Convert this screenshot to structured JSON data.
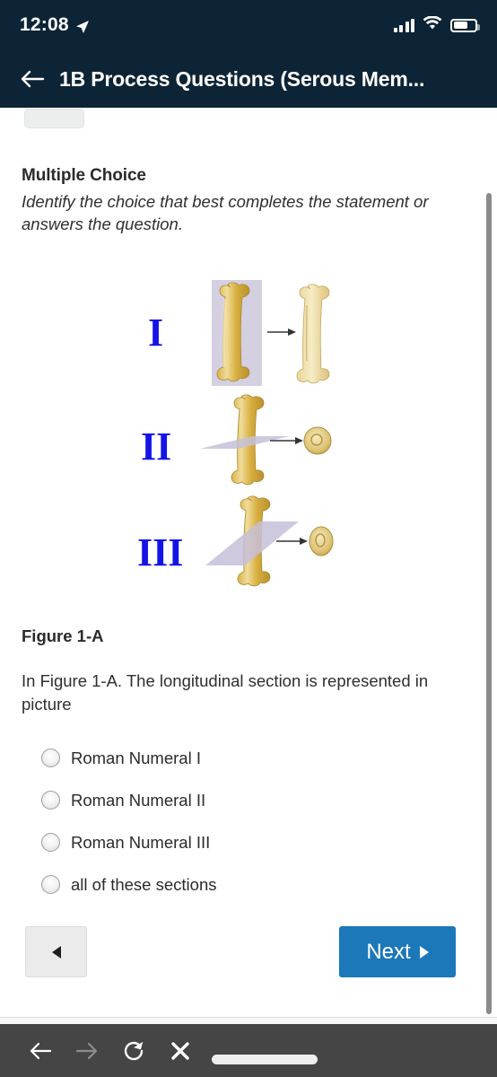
{
  "statusbar": {
    "time": "12:08",
    "location_icon": "location-arrow-icon",
    "signal_icon": "cellular-signal-icon",
    "wifi_icon": "wifi-icon",
    "battery_icon": "battery-icon"
  },
  "appbar": {
    "back_icon": "back-arrow-icon",
    "title": "1B Process Questions (Serous Mem..."
  },
  "main": {
    "section_heading": "Multiple Choice",
    "section_instructions": "Identify the choice that best completes the statement or answers the question.",
    "figure": {
      "caption": "Figure 1-A",
      "alt": "bone-sections-diagram",
      "rows": [
        {
          "numeral": "I",
          "section": "longitudinal",
          "result": "long-bone-split"
        },
        {
          "numeral": "II",
          "section": "transverse",
          "result": "round-cross-section"
        },
        {
          "numeral": "III",
          "section": "oblique",
          "result": "oval-cross-section"
        }
      ],
      "numeral_color": "#1414e6",
      "plane_color": "#c6c0d8",
      "bone_color": "#e0c068"
    },
    "question": "In Figure 1-A. The longitudinal section is represented in picture",
    "options": [
      {
        "label": "Roman Numeral I",
        "selected": false
      },
      {
        "label": "Roman Numeral II",
        "selected": false
      },
      {
        "label": "Roman Numeral III",
        "selected": false
      },
      {
        "label": "all of these sections",
        "selected": false
      }
    ],
    "nav": {
      "prev_icon": "triangle-left-icon",
      "next_label": "Next",
      "next_icon": "triangle-right-icon",
      "next_color": "#1c78b8"
    }
  },
  "browser_bar": {
    "back_icon": "browser-back-icon",
    "forward_icon": "browser-forward-icon",
    "reload_icon": "reload-icon",
    "stop_icon": "close-icon",
    "url_value": "",
    "url_placeholder": ""
  }
}
